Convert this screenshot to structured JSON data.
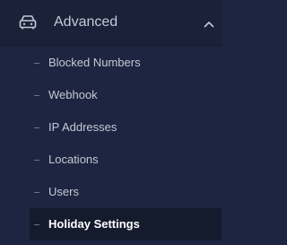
{
  "sidebar": {
    "section": {
      "title": "Advanced",
      "icon": "car-icon",
      "expanded": true,
      "chevron": "chevron-up-icon"
    },
    "items": [
      {
        "label": "Blocked Numbers",
        "active": false
      },
      {
        "label": "Webhook",
        "active": false
      },
      {
        "label": "IP Addresses",
        "active": false
      },
      {
        "label": "Locations",
        "active": false
      },
      {
        "label": "Users",
        "active": false
      },
      {
        "label": "Holiday Settings",
        "active": true
      }
    ]
  },
  "colors": {
    "background": "#1d2540",
    "header_background": "#1a2138",
    "active_background": "#141b2d",
    "text": "#c4c9d7",
    "active_text": "#ffffff"
  }
}
